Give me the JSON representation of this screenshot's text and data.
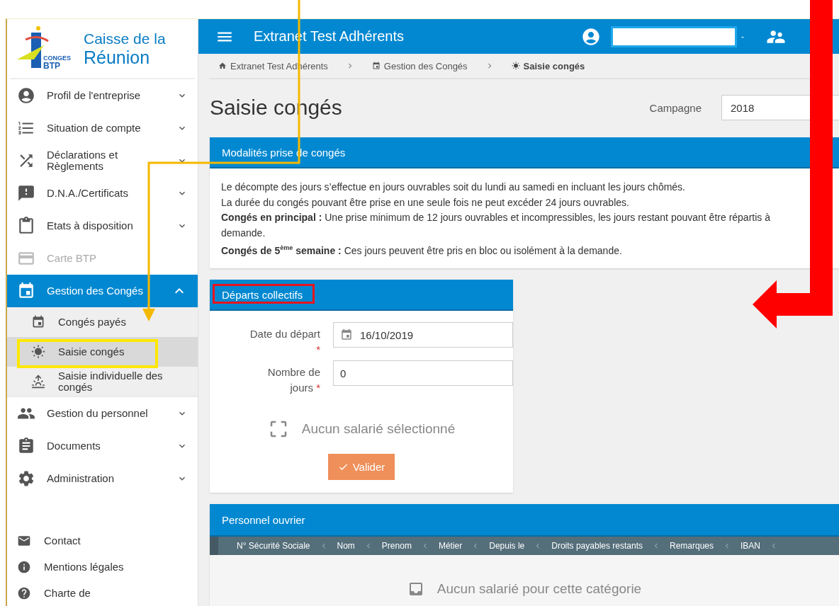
{
  "sidebar": {
    "logo": {
      "top": "CONGES",
      "bottom": "BTP"
    },
    "brand": [
      "Caisse de la",
      "Réunion"
    ],
    "items": [
      {
        "label": "Profil de l'entreprise",
        "disabled": false,
        "expanded": false,
        "selected": false
      },
      {
        "label": "Situation de compte",
        "disabled": false,
        "expanded": false,
        "selected": false
      },
      {
        "label": "Déclarations et Règlements",
        "disabled": false,
        "expanded": false,
        "selected": false
      },
      {
        "label": "D.N.A./Certificats",
        "disabled": false,
        "expanded": false,
        "selected": false
      },
      {
        "label": "Etats à disposition",
        "disabled": false,
        "expanded": false,
        "selected": false
      },
      {
        "label": "Carte BTP",
        "disabled": true,
        "expanded": false,
        "selected": false
      },
      {
        "label": "Gestion des Congés",
        "disabled": false,
        "expanded": true,
        "selected": true,
        "children": [
          {
            "label": "Congés payés",
            "selected": false
          },
          {
            "label": "Saisie congés",
            "selected": true
          },
          {
            "label": "Saisie individuelle des congés",
            "selected": false
          }
        ]
      },
      {
        "label": "Gestion du personnel",
        "disabled": false,
        "expanded": false,
        "selected": false
      },
      {
        "label": "Documents",
        "disabled": false,
        "expanded": false,
        "selected": false
      },
      {
        "label": "Administration",
        "disabled": false,
        "expanded": false,
        "selected": false
      }
    ],
    "footer": [
      "Contact",
      "Mentions légales",
      "Charte de"
    ]
  },
  "topbar": {
    "title": "Extranet Test Adhérents",
    "user_suffix": "-"
  },
  "breadcrumb": [
    {
      "label": "Extranet Test Adhérents",
      "current": false
    },
    {
      "label": "Gestion des Congés",
      "current": false
    },
    {
      "label": "Saisie congés",
      "current": true
    }
  ],
  "page": {
    "title": "Saisie congés",
    "campaign_label": "Campagne",
    "campaign_value": "2018"
  },
  "modalites": {
    "title": "Modalités prise de congés",
    "lines": [
      "Le décompte des jours s’effectue en jours ouvrables soit du lundi au samedi en incluant les jours chômés.",
      "La durée du congés pouvant être prise en une seule fois ne peut excéder 24 jours ouvrables.",
      "**Congés en principal :** Une prise minimum de 12 jours ouvrables et incompressibles, les jours restant pouvant être répartis à",
      "demande.",
      "**Congés de 5**$^{ème}$ **semaine :** Ces jours peuvent être pris en bloc ou isolément à la demande."
    ]
  },
  "departs": {
    "title": "Départs collectifs",
    "required_mark": "*",
    "fields": [
      {
        "label": "Date du départ",
        "required": true,
        "value": "16/10/2019",
        "kind": "date"
      },
      {
        "label": "Nombre de jours",
        "required": true,
        "value": "0",
        "kind": "number"
      }
    ],
    "empty": "Aucun salarié sélectionné",
    "button": "Valider"
  },
  "personnel": {
    "title": "Personnel ouvrier",
    "columns": [
      "N° Sécurité Sociale",
      "Nom",
      "Prenom",
      "Métier",
      "Depuis le",
      "Droits payables restants",
      "Remarques",
      "IBAN"
    ],
    "empty": "Aucun salarié pour cette catégorie"
  }
}
